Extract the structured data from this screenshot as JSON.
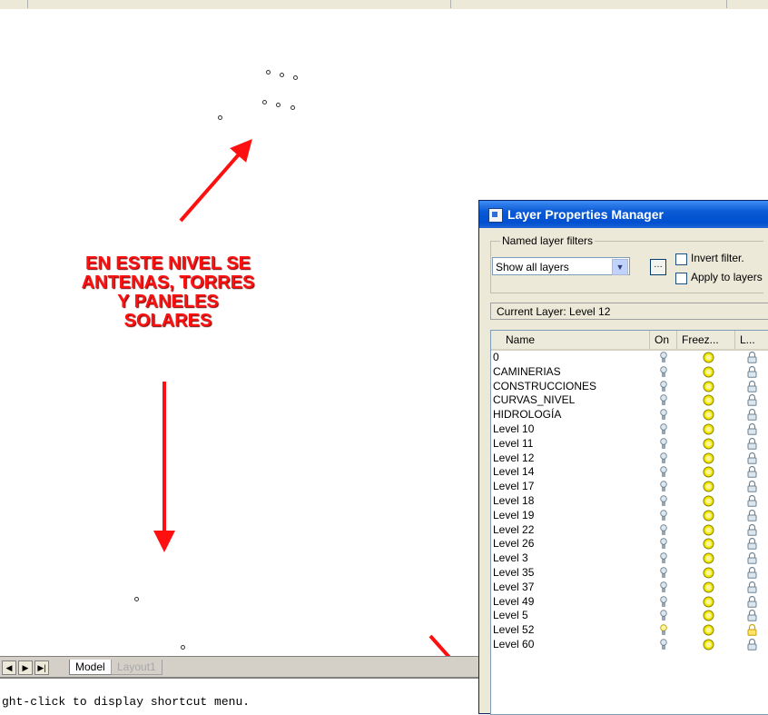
{
  "annotation": {
    "lines": [
      "EN ESTE NIVEL SE",
      "ANTENAS, TORRES",
      "Y PANELES",
      "SOLARES"
    ],
    "color": "#ff1010"
  },
  "tabs": {
    "nav_buttons": [
      "first-icon",
      "prev-icon",
      "next-icon",
      "last-icon"
    ],
    "model": "Model",
    "layout": "Layout1"
  },
  "command_line": {
    "text": "ght-click to display shortcut menu."
  },
  "layer_dialog": {
    "title": "Layer Properties Manager",
    "filters_group_label": "Named layer filters",
    "filter_selected": "Show all layers",
    "invert_filter_label": "Invert filter.",
    "invert_filter_checked": false,
    "apply_to_layers_label": "Apply to layers",
    "apply_to_layers_checked": false,
    "current_layer_label": "Current Layer:  Level 12",
    "columns": {
      "name": "Name",
      "on": "On",
      "freeze": "Freez...",
      "lock": "L..."
    },
    "layers": [
      {
        "name": "0",
        "on": true,
        "frozen": false,
        "locked": false
      },
      {
        "name": "CAMINERIAS",
        "on": true,
        "frozen": false,
        "locked": false
      },
      {
        "name": "CONSTRUCCIONES",
        "on": true,
        "frozen": false,
        "locked": false
      },
      {
        "name": "CURVAS_NIVEL",
        "on": true,
        "frozen": false,
        "locked": false
      },
      {
        "name": "HIDROLOGÍA",
        "on": true,
        "frozen": false,
        "locked": false
      },
      {
        "name": "Level 10",
        "on": true,
        "frozen": false,
        "locked": false
      },
      {
        "name": "Level 11",
        "on": true,
        "frozen": false,
        "locked": false
      },
      {
        "name": "Level 12",
        "on": true,
        "frozen": false,
        "locked": false
      },
      {
        "name": "Level 14",
        "on": true,
        "frozen": false,
        "locked": false
      },
      {
        "name": "Level 17",
        "on": true,
        "frozen": false,
        "locked": false
      },
      {
        "name": "Level 18",
        "on": true,
        "frozen": false,
        "locked": false
      },
      {
        "name": "Level 19",
        "on": true,
        "frozen": false,
        "locked": false
      },
      {
        "name": "Level 22",
        "on": true,
        "frozen": false,
        "locked": false
      },
      {
        "name": "Level 26",
        "on": true,
        "frozen": false,
        "locked": false
      },
      {
        "name": "Level 3",
        "on": true,
        "frozen": false,
        "locked": false
      },
      {
        "name": "Level 35",
        "on": true,
        "frozen": false,
        "locked": false
      },
      {
        "name": "Level 37",
        "on": true,
        "frozen": false,
        "locked": false
      },
      {
        "name": "Level 49",
        "on": true,
        "frozen": false,
        "locked": false
      },
      {
        "name": "Level 5",
        "on": true,
        "frozen": false,
        "locked": false
      },
      {
        "name": "Level 52",
        "on": true,
        "frozen": false,
        "locked": true,
        "highlighted_icons": true
      },
      {
        "name": "Level 60",
        "on": true,
        "frozen": false,
        "locked": false
      }
    ]
  }
}
